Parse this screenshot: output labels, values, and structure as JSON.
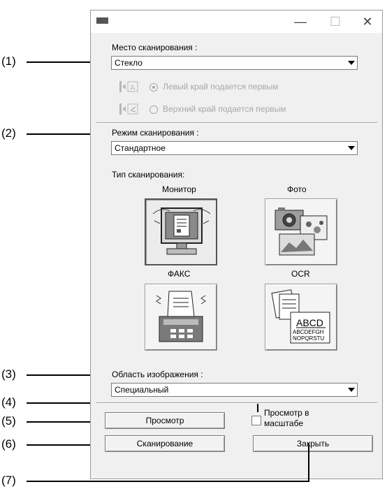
{
  "window": {
    "minimize_glyph": "—",
    "maximize_glyph": "☐",
    "close_glyph": "✕"
  },
  "callouts": [
    "(1)",
    "(2)",
    "(3)",
    "(4)",
    "(5)",
    "(6)",
    "(7)"
  ],
  "scan_location": {
    "label": "Место сканирования :",
    "value": "Стекло",
    "feed_left_label": "Левый край подается первым",
    "feed_top_label": "Верхний край подается первым",
    "feed_left_selected": true
  },
  "scan_mode": {
    "label": "Режим сканирования :",
    "value": "Стандартное"
  },
  "scan_type": {
    "label": "Тип сканирования:",
    "options": [
      {
        "label": "Монитор",
        "icon": "monitor-icon",
        "selected": true
      },
      {
        "label": "Фото",
        "icon": "camera-photo-icon",
        "selected": false
      },
      {
        "label": "ФАКС",
        "icon": "fax-icon",
        "selected": false
      },
      {
        "label": "OCR",
        "icon": "ocr-document-icon",
        "selected": false
      }
    ],
    "ocr_sample_big": "ABCD",
    "ocr_sample_line1": "ABCDEFGH",
    "ocr_sample_line2": "NOPQRSTU"
  },
  "image_area": {
    "label": "Область изображения :",
    "value": "Специальный"
  },
  "buttons": {
    "preview": "Просмотр",
    "scan": "Сканирование",
    "close": "Закрыть"
  },
  "zoom_preview": {
    "label_line1": "Просмотр в",
    "label_line2": "масштабе",
    "checked": false
  }
}
